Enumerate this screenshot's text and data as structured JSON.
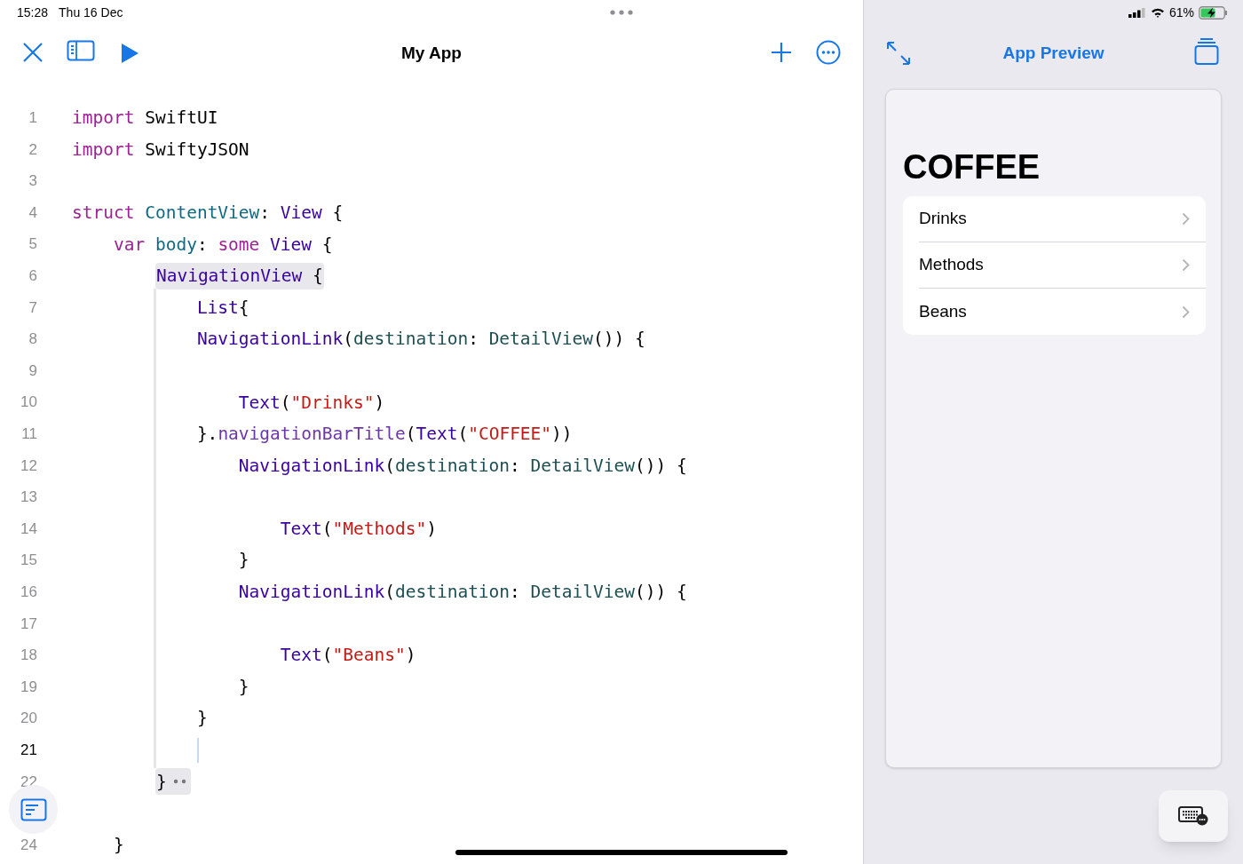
{
  "status_bar": {
    "time": "15:28",
    "date": "Thu 16 Dec",
    "battery": "61%"
  },
  "editor": {
    "title": "My App",
    "lines": [
      {
        "number": "1",
        "tokens": [
          {
            "kind": "keyword",
            "text": "import"
          },
          {
            "kind": "plain",
            "text": " SwiftUI"
          }
        ]
      },
      {
        "number": "2",
        "tokens": [
          {
            "kind": "keyword",
            "text": "import"
          },
          {
            "kind": "plain",
            "text": " SwiftyJSON"
          }
        ]
      },
      {
        "number": "3"
      },
      {
        "number": "4",
        "tokens": [
          {
            "kind": "keyword",
            "text": "struct "
          },
          {
            "kind": "decl",
            "text": "ContentView"
          },
          {
            "kind": "plain",
            "text": ": "
          },
          {
            "kind": "type",
            "text": "View"
          },
          {
            "kind": "plain",
            "text": " {"
          }
        ]
      },
      {
        "number": "5",
        "tokens": [
          {
            "kind": "keyword",
            "text": "    var "
          },
          {
            "kind": "decl",
            "text": "body"
          },
          {
            "kind": "plain",
            "text": ": "
          },
          {
            "kind": "keyword",
            "text": "some "
          },
          {
            "kind": "type",
            "text": "View"
          },
          {
            "kind": "plain",
            "text": " {"
          }
        ]
      },
      {
        "number": "6",
        "highlighted": true,
        "tokens": [
          {
            "kind": "type",
            "text": "        NavigationView"
          },
          {
            "kind": "plain",
            "text": " {"
          }
        ]
      },
      {
        "number": "7",
        "tokens": [
          {
            "kind": "type",
            "text": "            List"
          },
          {
            "kind": "plain",
            "text": "{"
          }
        ]
      },
      {
        "number": "8",
        "tokens": [
          {
            "kind": "type",
            "text": "            NavigationLink"
          },
          {
            "kind": "plain",
            "text": "("
          },
          {
            "kind": "param",
            "text": "destination"
          },
          {
            "kind": "plain",
            "text": ": "
          },
          {
            "kind": "param",
            "text": "DetailView"
          },
          {
            "kind": "plain",
            "text": "()) {"
          }
        ]
      },
      {
        "number": "9"
      },
      {
        "number": "10",
        "tokens": [
          {
            "kind": "type",
            "text": "                Text"
          },
          {
            "kind": "plain",
            "text": "("
          },
          {
            "kind": "string",
            "text": "\"Drinks\""
          },
          {
            "kind": "plain",
            "text": ")"
          }
        ]
      },
      {
        "number": "11",
        "tokens": [
          {
            "kind": "plain",
            "text": "            }."
          },
          {
            "kind": "method",
            "text": "navigationBarTitle"
          },
          {
            "kind": "plain",
            "text": "("
          },
          {
            "kind": "type",
            "text": "Text"
          },
          {
            "kind": "plain",
            "text": "("
          },
          {
            "kind": "string",
            "text": "\"COFFEE\""
          },
          {
            "kind": "plain",
            "text": "))"
          }
        ]
      },
      {
        "number": "12",
        "tokens": [
          {
            "kind": "type",
            "text": "                NavigationLink"
          },
          {
            "kind": "plain",
            "text": "("
          },
          {
            "kind": "param",
            "text": "destination"
          },
          {
            "kind": "plain",
            "text": ": "
          },
          {
            "kind": "param",
            "text": "DetailView"
          },
          {
            "kind": "plain",
            "text": "()) {"
          }
        ]
      },
      {
        "number": "13"
      },
      {
        "number": "14",
        "tokens": [
          {
            "kind": "type",
            "text": "                    Text"
          },
          {
            "kind": "plain",
            "text": "("
          },
          {
            "kind": "string",
            "text": "\"Methods\""
          },
          {
            "kind": "plain",
            "text": ")"
          }
        ]
      },
      {
        "number": "15",
        "tokens": [
          {
            "kind": "plain",
            "text": "                }"
          }
        ]
      },
      {
        "number": "16",
        "tokens": [
          {
            "kind": "type",
            "text": "                NavigationLink"
          },
          {
            "kind": "plain",
            "text": "("
          },
          {
            "kind": "param",
            "text": "destination"
          },
          {
            "kind": "plain",
            "text": ": "
          },
          {
            "kind": "param",
            "text": "DetailView"
          },
          {
            "kind": "plain",
            "text": "()) {"
          }
        ]
      },
      {
        "number": "17"
      },
      {
        "number": "18",
        "tokens": [
          {
            "kind": "type",
            "text": "                    Text"
          },
          {
            "kind": "plain",
            "text": "("
          },
          {
            "kind": "string",
            "text": "\"Beans\""
          },
          {
            "kind": "plain",
            "text": ")"
          }
        ]
      },
      {
        "number": "19",
        "tokens": [
          {
            "kind": "plain",
            "text": "                }"
          }
        ]
      },
      {
        "number": "20",
        "tokens": [
          {
            "kind": "plain",
            "text": "            }"
          }
        ]
      },
      {
        "number": "21",
        "current": true
      },
      {
        "number": "22",
        "highlighted": true,
        "folded": true,
        "tokens": [
          {
            "kind": "plain",
            "text": "        }"
          }
        ]
      },
      {
        "number": "24",
        "tokens": [
          {
            "kind": "plain",
            "text": "    }"
          }
        ]
      }
    ]
  },
  "preview": {
    "title": "App Preview",
    "nav_title": "COFFEE",
    "items": [
      {
        "label": "Drinks"
      },
      {
        "label": "Methods"
      },
      {
        "label": "Beans"
      }
    ]
  }
}
